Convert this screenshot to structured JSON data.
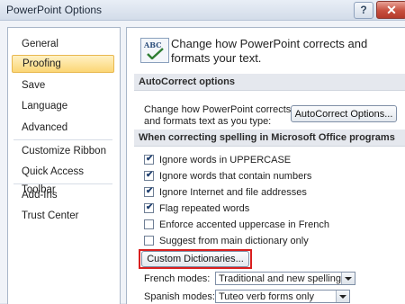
{
  "window": {
    "title": "PowerPoint Options",
    "help_glyph": "?",
    "close_glyph": "✕"
  },
  "sidebar": {
    "items": [
      {
        "label": "General"
      },
      {
        "label": "Proofing",
        "selected": true
      },
      {
        "label": "Save"
      },
      {
        "label": "Language"
      },
      {
        "label": "Advanced"
      },
      {
        "label": "Customize Ribbon"
      },
      {
        "label": "Quick Access Toolbar"
      },
      {
        "label": "Add-Ins"
      },
      {
        "label": "Trust Center"
      }
    ]
  },
  "main": {
    "icon_text": "ABC",
    "intro": "Change how PowerPoint corrects and formats your text.",
    "autocorrect": {
      "header": "AutoCorrect options",
      "description": "Change how PowerPoint corrects and formats text as you type:",
      "button_label": "AutoCorrect Options..."
    },
    "spelling": {
      "header": "When correcting spelling in Microsoft Office programs",
      "options": [
        {
          "label": "Ignore words in UPPERCASE",
          "checked": true
        },
        {
          "label": "Ignore words that contain numbers",
          "checked": true
        },
        {
          "label": "Ignore Internet and file addresses",
          "checked": true
        },
        {
          "label": "Flag repeated words",
          "checked": true
        },
        {
          "label": "Enforce accented uppercase in French",
          "checked": false
        },
        {
          "label": "Suggest from main dictionary only",
          "checked": false
        }
      ],
      "custom_dictionaries_label": "Custom Dictionaries...",
      "french_modes": {
        "label": "French modes:",
        "value": "Traditional and new spellings"
      },
      "spanish_modes": {
        "label": "Spanish modes:",
        "value": "Tuteo verb forms only"
      }
    }
  },
  "colors": {
    "highlight": "#d91f1f",
    "selected_nav": "#fbd675"
  }
}
